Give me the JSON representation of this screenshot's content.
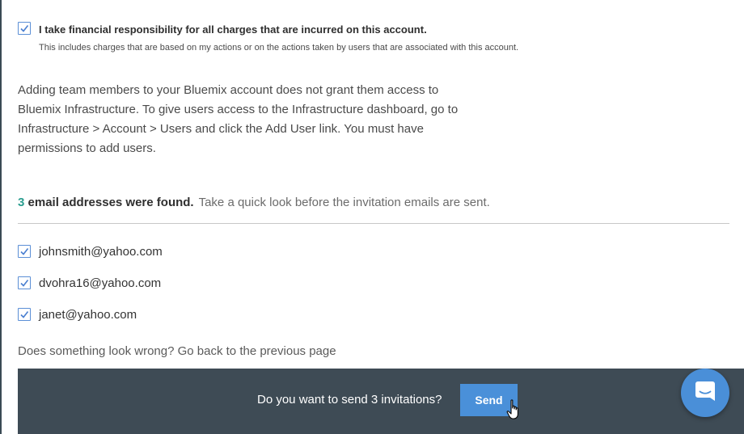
{
  "responsibility": {
    "checked": true,
    "label": "I take financial responsibility for all charges that are incurred on this account.",
    "note": "This includes charges that are based on my actions or on the actions taken by users that are associated with this account."
  },
  "info_text": "Adding team members to your Bluemix account does not grant them access to Bluemix Infrastructure. To give users access to the Infrastructure dashboard, go to Infrastructure > Account > Users and click the Add User link. You must have permissions to add users.",
  "found": {
    "count": "3",
    "label": "email addresses were found.",
    "hint": "Take a quick look before the invitation emails are sent."
  },
  "emails": [
    {
      "address": "johnsmith@yahoo.com",
      "checked": true
    },
    {
      "address": "dvohra16@yahoo.com",
      "checked": true
    },
    {
      "address": "janet@yahoo.com",
      "checked": true
    }
  ],
  "wrong_prompt": "Does something look wrong? Go back to the previous page",
  "send_bar": {
    "question": "Do you want to send 3 invitations?",
    "button_label": "Send"
  },
  "icons": {
    "checkbox": "checkmark-icon",
    "chat": "chat-bubble-icon",
    "cursor": "hand-pointer-icon"
  },
  "colors": {
    "accent": "#4a90d9",
    "count": "#2a9d8f",
    "bar": "#3e4b55"
  }
}
